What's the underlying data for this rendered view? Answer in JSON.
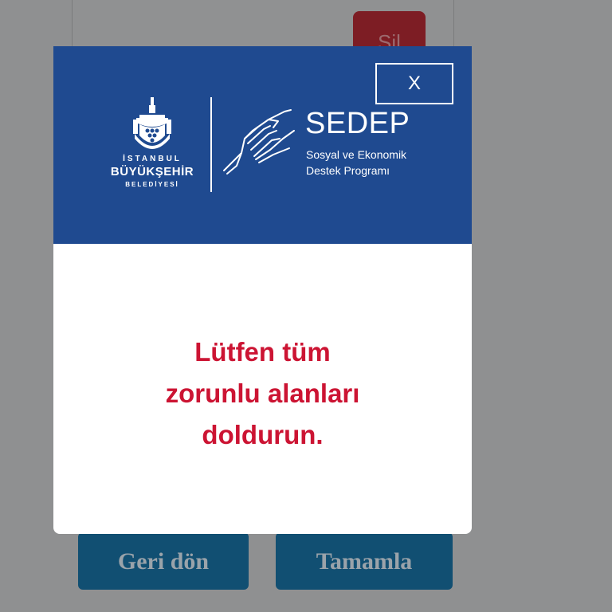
{
  "background": {
    "delete_label": "Sil",
    "back_label": "Geri dön",
    "complete_label": "Tamamla"
  },
  "modal": {
    "close_label": "X",
    "municipality": {
      "line1": "İSTANBUL",
      "line2": "BÜYÜKŞEHİR",
      "line3": "BELEDİYESİ"
    },
    "program": {
      "title": "SEDEP",
      "subtitle_line1": "Sosyal ve Ekonomik",
      "subtitle_line2": "Destek Programı"
    },
    "message_lines": [
      "Lütfen tüm",
      "zorunlu alanları",
      "doldurun."
    ]
  },
  "colors": {
    "header_blue": "#1f4a90",
    "message_red": "#cc1433",
    "button_blue": "#114f72",
    "overlay_gray": "#8f9091"
  },
  "icons": [
    "ibb-emblem-icon",
    "hands-icon",
    "close-icon"
  ]
}
